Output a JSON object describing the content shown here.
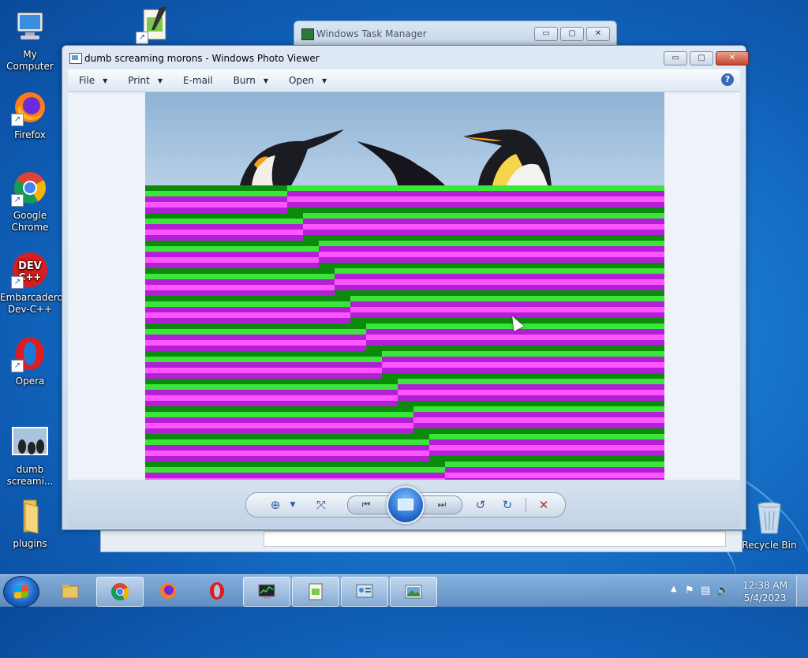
{
  "desktop": {
    "icons": [
      {
        "label": "My Computer",
        "icon": "computer-icon"
      },
      {
        "label": "Firefox",
        "icon": "firefox-icon"
      },
      {
        "label": "Google Chrome",
        "icon": "chrome-icon"
      },
      {
        "label": "Embarcadero Dev-C++",
        "icon": "devcpp-icon"
      },
      {
        "label": "Opera",
        "icon": "opera-icon"
      },
      {
        "label": "dumb screami...",
        "icon": "image-thumbnail-icon"
      },
      {
        "label": "plugins",
        "icon": "folder-icon"
      },
      {
        "label": "Recycle Bin",
        "icon": "recycle-bin-icon"
      }
    ]
  },
  "task_manager": {
    "title": "Windows Task Manager"
  },
  "photo_viewer": {
    "title": "dumb screaming morons - Windows Photo Viewer",
    "menu": [
      {
        "label": "File",
        "has_dropdown": true
      },
      {
        "label": "Print",
        "has_dropdown": true
      },
      {
        "label": "E-mail",
        "has_dropdown": false
      },
      {
        "label": "Burn",
        "has_dropdown": true
      },
      {
        "label": "Open",
        "has_dropdown": true
      }
    ],
    "help_glyph": "?",
    "window_buttons": {
      "minimize": "▭",
      "maximize": "▢",
      "close": "✕"
    },
    "controls": [
      {
        "name": "zoom",
        "glyph": "⊕"
      },
      {
        "name": "actual-size",
        "glyph": "⤧"
      },
      {
        "name": "previous",
        "glyph": "⏮"
      },
      {
        "name": "slideshow",
        "glyph": ""
      },
      {
        "name": "next",
        "glyph": "⏭"
      },
      {
        "name": "rotate-counterclockwise",
        "glyph": "↺"
      },
      {
        "name": "rotate-clockwise",
        "glyph": "↻"
      },
      {
        "name": "delete",
        "glyph": "✕"
      }
    ],
    "colors": {
      "glitch_green": "#39e639",
      "glitch_dark_green": "#0b8a0b",
      "glitch_magenta": "#ff55ff",
      "glitch_purple": "#b21fd6",
      "delete_red": "#c8281e"
    }
  },
  "taskbar": {
    "apps": [
      {
        "name": "explorer",
        "icon": "folder-icon"
      },
      {
        "name": "chrome",
        "icon": "chrome-icon"
      },
      {
        "name": "firefox",
        "icon": "firefox-icon"
      },
      {
        "name": "opera",
        "icon": "opera-icon"
      },
      {
        "name": "task-manager",
        "icon": "task-manager-icon"
      },
      {
        "name": "notepad",
        "icon": "notepad-icon"
      },
      {
        "name": "control-panel",
        "icon": "control-panel-icon"
      },
      {
        "name": "photo-viewer",
        "icon": "photo-viewer-icon",
        "active": true
      }
    ],
    "time": "12:38 AM",
    "date": "5/4/2023"
  }
}
